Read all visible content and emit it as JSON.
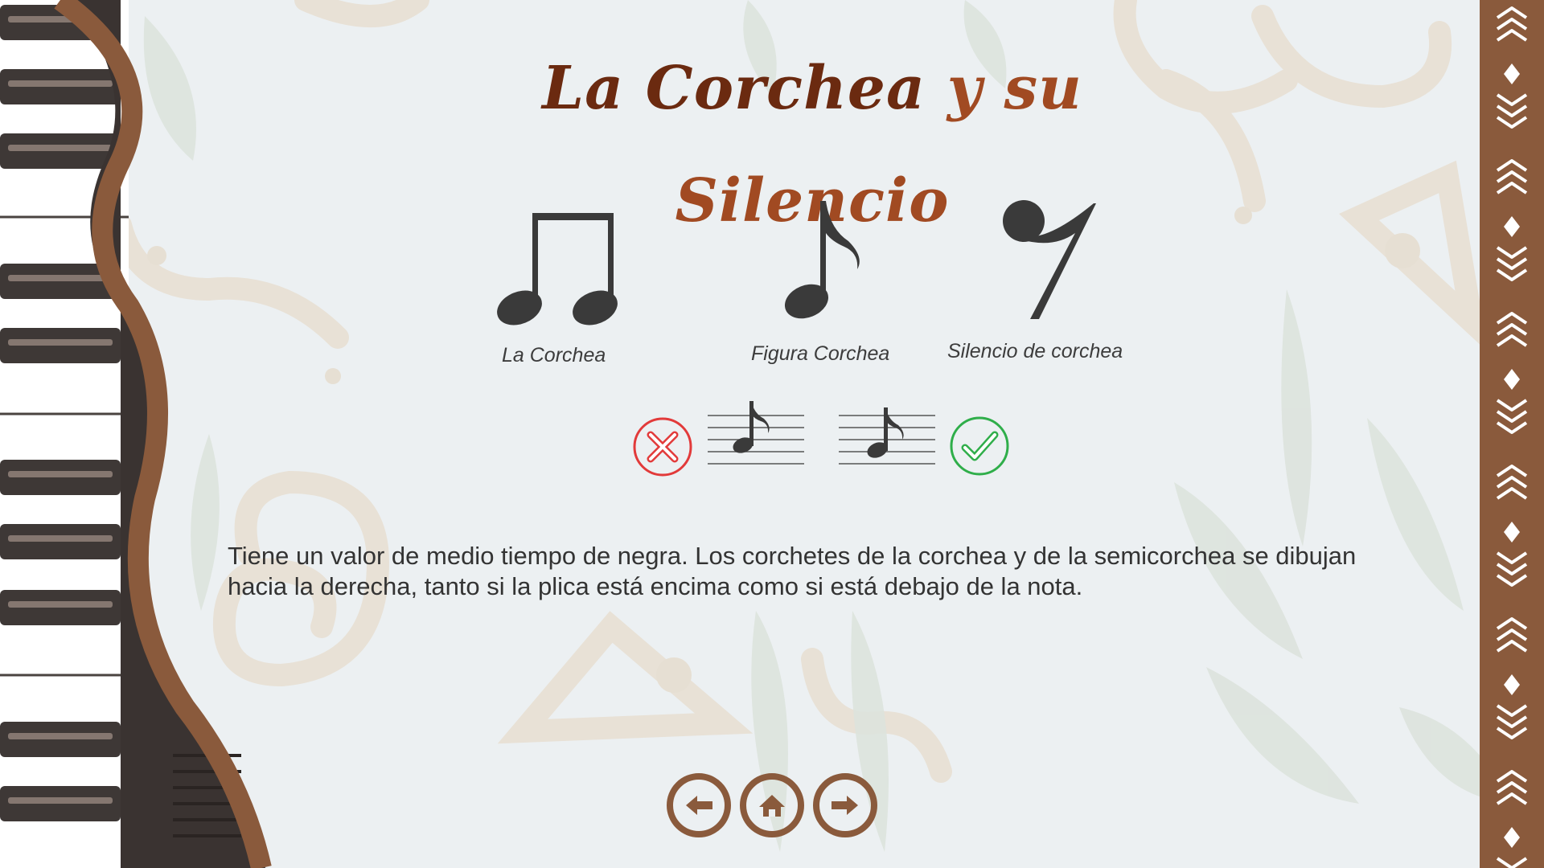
{
  "slide": {
    "title_part1": "La Corchea",
    "title_part2": " y su Silencio",
    "figures": [
      {
        "label": "La Corchea",
        "icon": "beamed-eighth-notes-icon"
      },
      {
        "label": "Figura Corchea",
        "icon": "eighth-note-icon"
      },
      {
        "label": "Silencio de corchea",
        "icon": "eighth-rest-icon"
      }
    ],
    "examples": [
      {
        "icon": "incorrect-icon",
        "status": "incorrect"
      },
      {
        "icon": "correct-icon",
        "status": "correct"
      }
    ],
    "description": "Tiene un valor de medio tiempo de negra. Los corchetes de la corchea y de la semicorchea se dibujan hacia la derecha, tanto si la plica está encima como si está debajo de la nota."
  },
  "navigation": [
    {
      "name": "previous",
      "icon": "arrow-left-icon"
    },
    {
      "name": "home",
      "icon": "home-icon"
    },
    {
      "name": "next",
      "icon": "arrow-right-icon"
    }
  ],
  "colors": {
    "background": "#ecf0f2",
    "brown": "#8a5a3c",
    "title_dark": "#6b2a10",
    "title_light": "#a14a22",
    "incorrect": "#e23a3a",
    "correct": "#2fae4a",
    "ink": "#3a3a3a"
  }
}
